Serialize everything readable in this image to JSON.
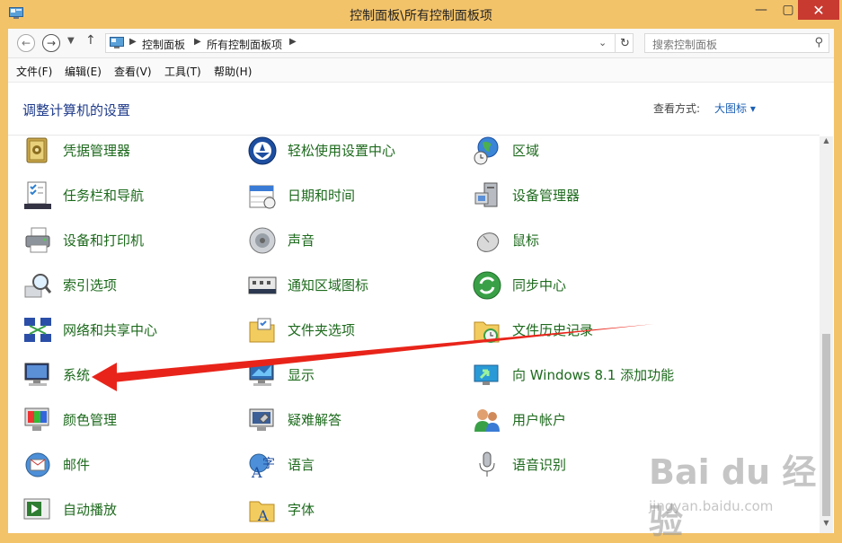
{
  "window": {
    "title": "控制面板\\所有控制面板项",
    "min_glyph": "—",
    "max_glyph": "▢",
    "close_glyph": "✕"
  },
  "address": {
    "crumbs": [
      "控制面板",
      "所有控制面板项"
    ],
    "search_placeholder": "搜索控制面板"
  },
  "menu": [
    "文件(F)",
    "编辑(E)",
    "查看(V)",
    "工具(T)",
    "帮助(H)"
  ],
  "content": {
    "heading": "调整计算机的设置",
    "viewby_label": "查看方式:",
    "viewby_value": "大图标 ▾"
  },
  "items": {
    "col1": [
      "凭据管理器",
      "任务栏和导航",
      "设备和打印机",
      "索引选项",
      "网络和共享中心",
      "系统",
      "颜色管理",
      "邮件",
      "自动播放"
    ],
    "col2": [
      "轻松使用设置中心",
      "日期和时间",
      "声音",
      "通知区域图标",
      "文件夹选项",
      "显示",
      "疑难解答",
      "语言",
      "字体"
    ],
    "col3": [
      "区域",
      "设备管理器",
      "鼠标",
      "同步中心",
      "文件历史记录",
      "向 Windows 8.1 添加功能",
      "用户帐户",
      "语音识别"
    ]
  },
  "watermark": {
    "brand": "Bai du 经验",
    "url": "jingyan.baidu.com"
  },
  "colors": {
    "frame": "#f3c36a",
    "close": "#c83a30",
    "link_green": "#1d6a1d",
    "heading_blue": "#1e3a8a",
    "annotation_arrow": "#e8241a"
  }
}
